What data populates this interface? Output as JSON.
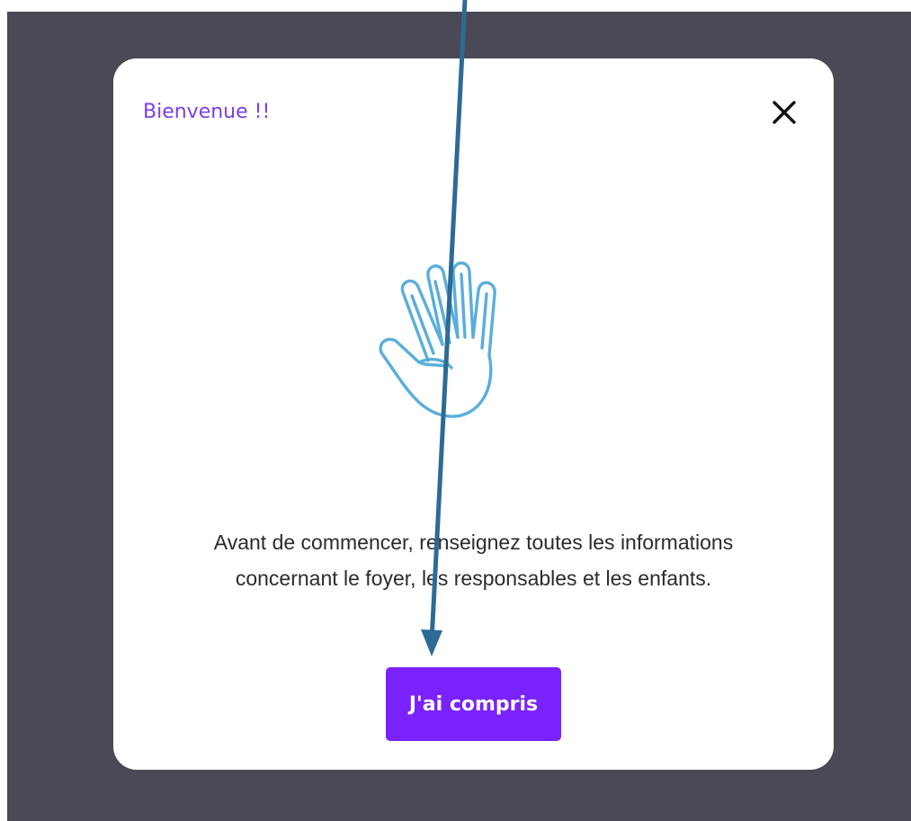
{
  "modal": {
    "title": "Bienvenue !!",
    "message_lines": [
      "Avant de commencer, renseignez toutes les informations",
      "concernant le foyer, les responsables et les enfants."
    ],
    "confirm_label": "J'ai compris",
    "close_icon": "close-icon",
    "illustration_icon": "waving-hand-icon"
  },
  "colors": {
    "overlay": "#4a4955",
    "title": "#7b3fe4",
    "button": "#7a22fb",
    "hand_stroke": "#5aaedb",
    "arrow": "#2d6b96"
  }
}
